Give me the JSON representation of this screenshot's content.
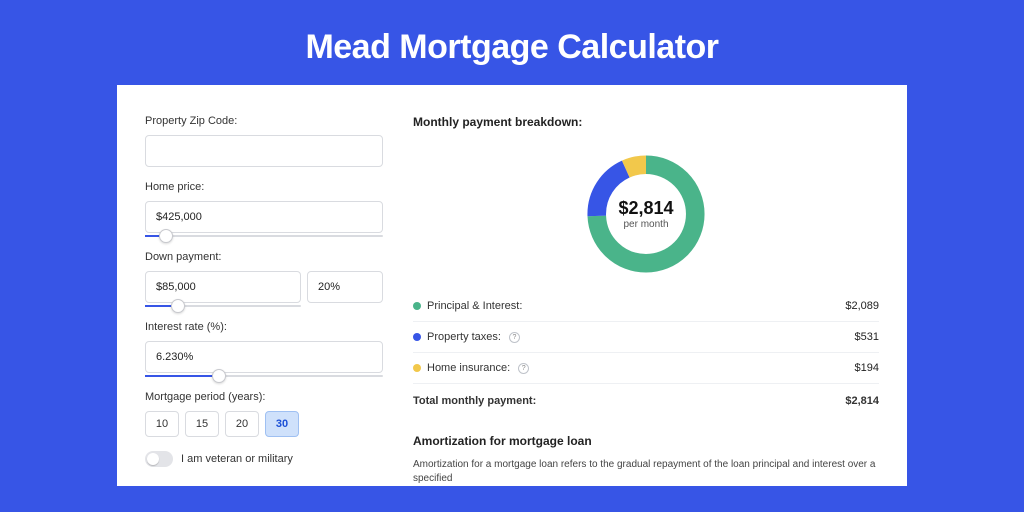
{
  "page": {
    "title": "Mead Mortgage Calculator"
  },
  "form": {
    "zip": {
      "label": "Property Zip Code:",
      "value": ""
    },
    "price": {
      "label": "Home price:",
      "value": "$425,000",
      "slider_pct": 9
    },
    "down": {
      "label": "Down payment:",
      "amount": "$85,000",
      "percent": "20%",
      "slider_pct": 21
    },
    "rate": {
      "label": "Interest rate (%):",
      "value": "6.230%",
      "slider_pct": 31
    },
    "period": {
      "label": "Mortgage period (years):",
      "options": [
        "10",
        "15",
        "20",
        "30"
      ],
      "active_index": 3
    },
    "veteran": {
      "label": "I am veteran or military",
      "on": false
    }
  },
  "breakdown": {
    "heading": "Monthly payment breakdown:",
    "center_amount": "$2,814",
    "center_sub": "per month",
    "items": [
      {
        "label": "Principal & Interest:",
        "value": "$2,089",
        "color": "#4ab48a",
        "info": false
      },
      {
        "label": "Property taxes:",
        "value": "$531",
        "color": "#3755e6",
        "info": true
      },
      {
        "label": "Home insurance:",
        "value": "$194",
        "color": "#f2c84b",
        "info": true
      }
    ],
    "total_label": "Total monthly payment:",
    "total_value": "$2,814"
  },
  "chart_data": {
    "type": "pie",
    "title": "Monthly payment breakdown",
    "categories": [
      "Principal & Interest",
      "Property taxes",
      "Home insurance"
    ],
    "values": [
      2089,
      531,
      194
    ],
    "colors": [
      "#4ab48a",
      "#3755e6",
      "#f2c84b"
    ],
    "center_label": "$2,814 per month"
  },
  "amort": {
    "heading": "Amortization for mortgage loan",
    "desc": "Amortization for a mortgage loan refers to the gradual repayment of the loan principal and interest over a specified"
  }
}
